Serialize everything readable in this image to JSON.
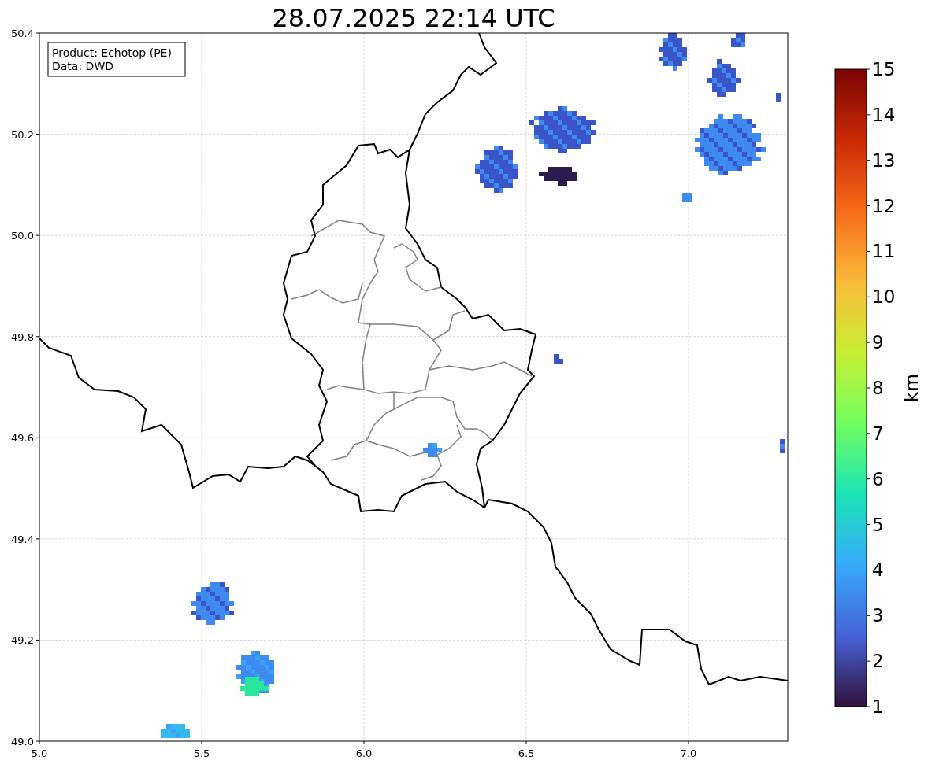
{
  "title": "28.07.2025 22:14 UTC",
  "info_box": [
    "Product: Echotop (PE)",
    "Data: DWD"
  ],
  "x_ticks": [
    "5.0",
    "5.5",
    "6.0",
    "6.5",
    "7.0"
  ],
  "y_ticks": [
    "50.4",
    "50.2",
    "50.0",
    "49.8",
    "49.6",
    "49.4",
    "49.2",
    "49.0"
  ],
  "colorbar": {
    "label": "km",
    "ticks": [
      "15",
      "14",
      "13",
      "12",
      "11",
      "10",
      "9",
      "8",
      "7",
      "6",
      "5",
      "4",
      "3",
      "2",
      "1"
    ]
  }
}
